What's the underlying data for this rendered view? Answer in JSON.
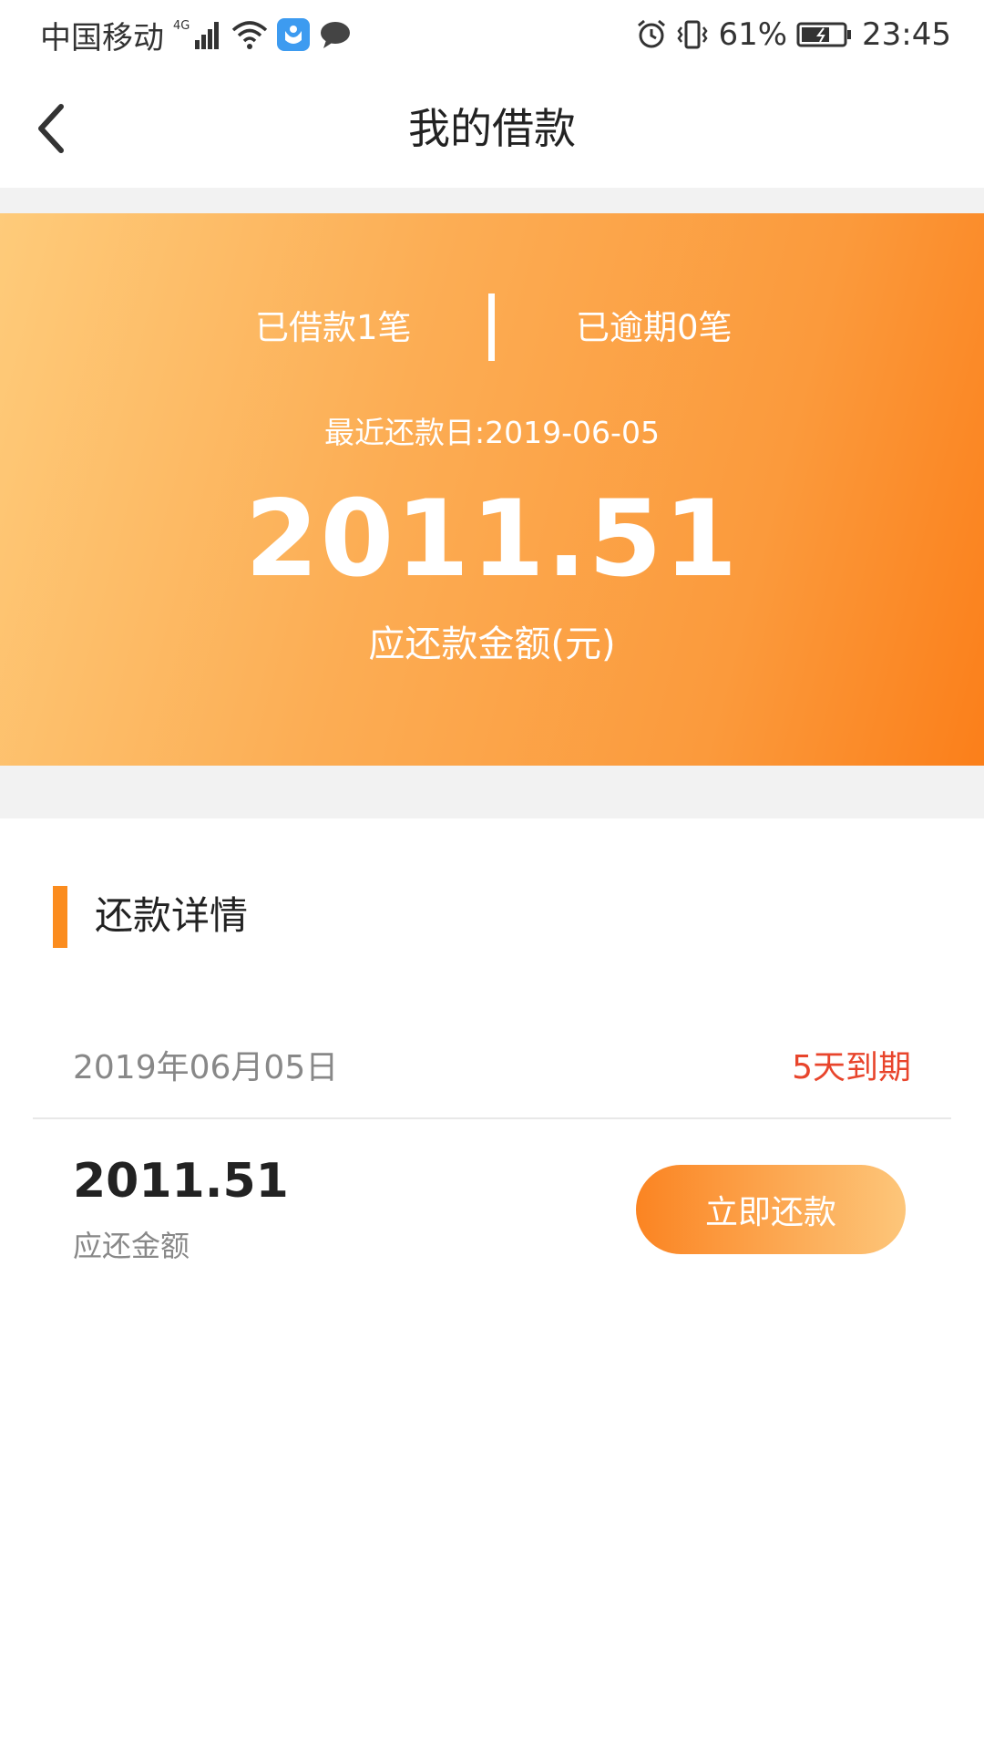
{
  "status_bar": {
    "carrier": "中国移动",
    "network": "4G",
    "battery": "61%",
    "time": "23:45",
    "icons": [
      "signal-icon",
      "wifi-icon",
      "app-notification-icon",
      "chat-notification-icon",
      "alarm-icon",
      "vibrate-icon",
      "battery-icon"
    ]
  },
  "nav": {
    "title": "我的借款",
    "back_icon": "chevron-left-icon"
  },
  "summary": {
    "borrowed_count": "已借款1笔",
    "overdue_count": "已逾期0笔",
    "recent_repay_date": "最近还款日:2019-06-05",
    "amount": "2011.51",
    "amount_label": "应还款金额(元)"
  },
  "details": {
    "section_title": "还款详情",
    "items": [
      {
        "due_date": "2019年06月05日",
        "due_status": "5天到期",
        "amount": "2011.51",
        "amount_label": "应还金额",
        "action_label": "立即还款"
      }
    ]
  },
  "colors": {
    "accent": "#fb8c1e",
    "banner_start": "#fecb7a",
    "banner_end": "#fb7f1a",
    "due_status": "#e8452c"
  }
}
